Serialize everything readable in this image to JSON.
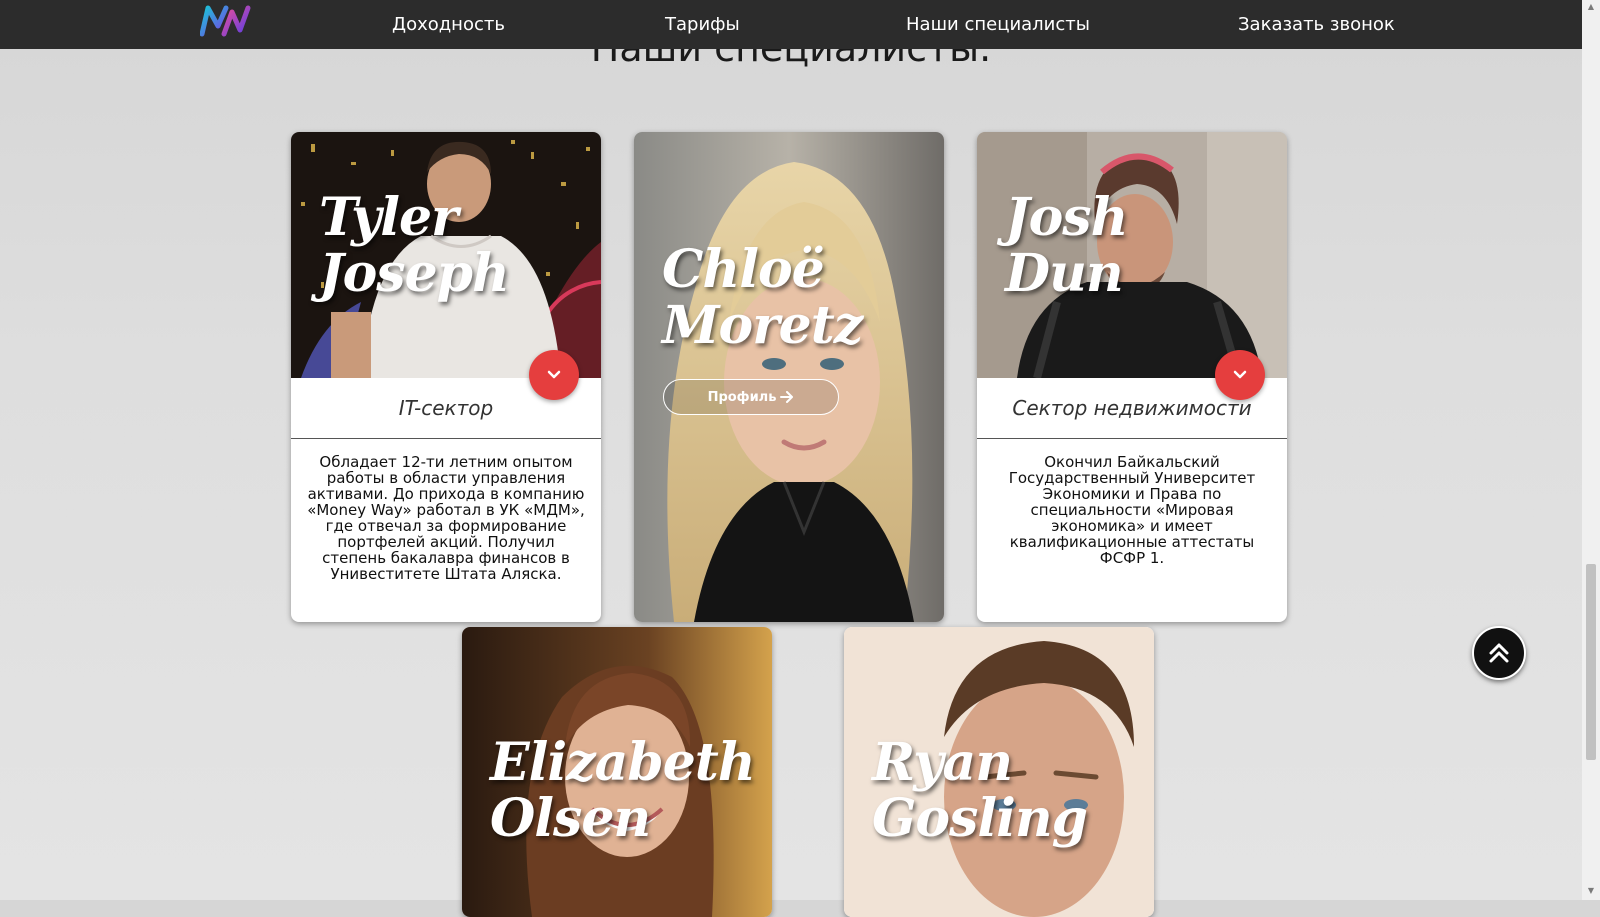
{
  "nav": {
    "logo_text": "MW",
    "links": [
      "Доходность",
      "Тарифы",
      "Наши специалисты",
      "Заказать звонок"
    ]
  },
  "section": {
    "title": "Наши специалисты."
  },
  "specialists": [
    {
      "first": "Tyler",
      "last": "Joseph",
      "sector": "IT-сектор",
      "bio": "Обладает 12-ти летним опытом работы в области управления активами. До прихода в компанию «Money Way» работал в УК «МДМ», где отвечал за формирование портфелей акций. Получил степень бакалавра финансов в Унивеститете Штата Аляска."
    },
    {
      "first": "Chloë",
      "last": "Moretz",
      "profile_button": "Профиль"
    },
    {
      "first": "Josh",
      "last": "Dun",
      "sector": "Сектор недвижимости",
      "bio": "Окончил Байкальский Государственный Университет Экономики и Права по специальности «Мировая экономика» и имеет квалификационные аттестаты ФСФР 1."
    },
    {
      "first": "Elizabeth",
      "last": "Olsen"
    },
    {
      "first": "Ryan",
      "last": "Gosling"
    }
  ],
  "colors": {
    "accent": "#e53e3e",
    "nav_bg": "#2c2c2c"
  },
  "icons": [
    "chevron-down-icon",
    "arrow-right-icon",
    "double-chevron-up-icon"
  ]
}
